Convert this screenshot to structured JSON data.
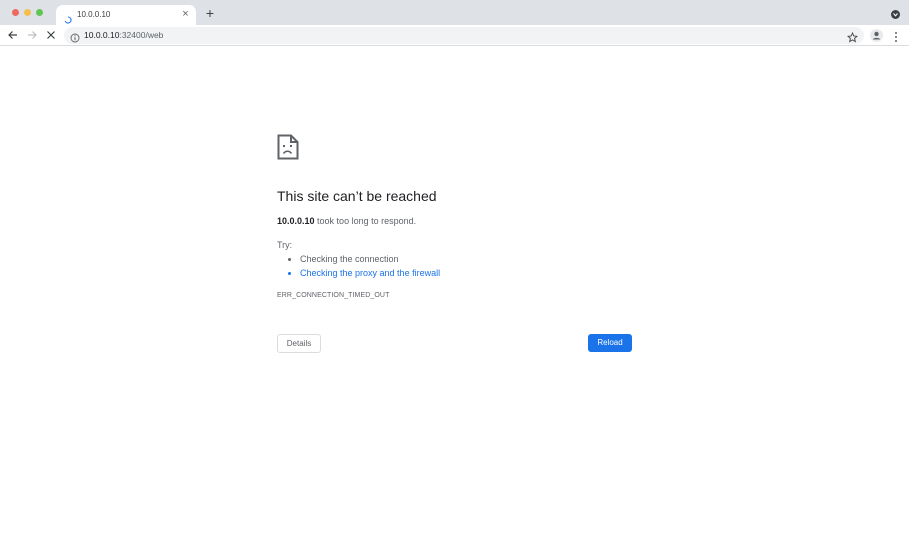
{
  "window": {
    "traffic_lights": [
      "close",
      "minimize",
      "maximize"
    ],
    "colors": {
      "close": "#ed6a5e",
      "minimize": "#f5bf4f",
      "maximize": "#61c554"
    }
  },
  "tab": {
    "title": "10.0.0.10",
    "close_label": "×",
    "loading": true
  },
  "new_tab_label": "+",
  "toolbar": {
    "url_host": "10.0.0.10",
    "url_path": ":32400/web"
  },
  "error": {
    "heading": "This site can’t be reached",
    "host": "10.0.0.10",
    "message": " took too long to respond.",
    "try_label": "Try:",
    "suggestions": [
      {
        "text": "Checking the connection",
        "is_link": false
      },
      {
        "text": "Checking the proxy and the firewall",
        "is_link": true
      }
    ],
    "code": "ERR_CONNECTION_TIMED_OUT",
    "details_label": "Details",
    "reload_label": "Reload"
  },
  "colors": {
    "accent": "#1a73e8",
    "text": "#202124",
    "muted": "#5f6368"
  },
  "icons": [
    "spinner-icon",
    "close-icon",
    "plus-icon",
    "back-arrow-icon",
    "forward-arrow-icon",
    "stop-loading-icon",
    "info-icon",
    "star-icon",
    "account-icon",
    "kebab-menu-icon",
    "sad-document-icon",
    "profile-menu-icon"
  ]
}
